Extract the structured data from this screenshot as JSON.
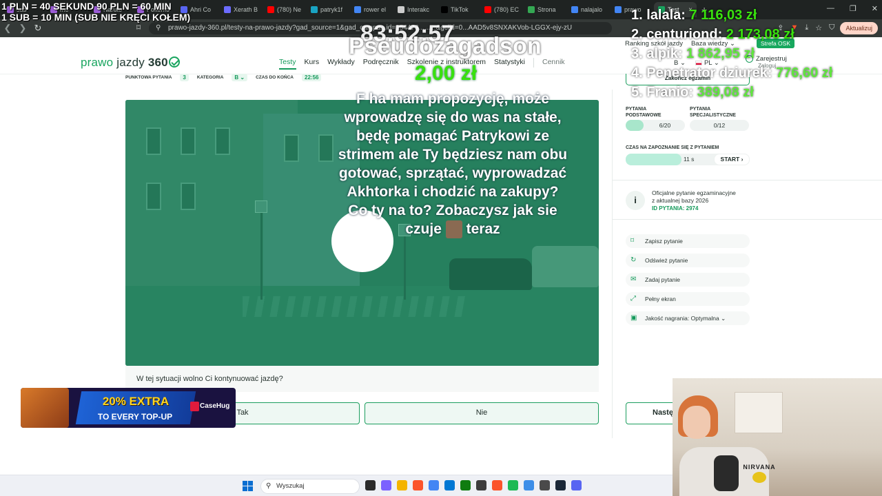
{
  "browser": {
    "tabs": [
      {
        "label": "sub",
        "color": "#9b5cd6"
      },
      {
        "label": "mo",
        "color": "#9b5cd6"
      },
      {
        "label": "Naruto",
        "color": "#9b5cd6"
      },
      {
        "label": "Pokémo",
        "color": "#9b5cd6"
      },
      {
        "label": "Ahri Co",
        "color": "#5865f2"
      },
      {
        "label": "Xerath B",
        "color": "#6c6cff"
      },
      {
        "label": "(780) Ne",
        "color": "#ff0000"
      },
      {
        "label": "patryk1f",
        "color": "#19a3c2"
      },
      {
        "label": "rower el",
        "color": "#4285f4"
      },
      {
        "label": "Interakc",
        "color": "#cccccc"
      },
      {
        "label": "TikTok",
        "color": "#000000"
      },
      {
        "label": "(780) EC",
        "color": "#ff0000"
      },
      {
        "label": "Strona",
        "color": "#34a853"
      },
      {
        "label": "nalajalo",
        "color": "#4285f4"
      },
      {
        "label": "prawo",
        "color": "#4285f4"
      },
      {
        "label": "Test",
        "color": "#19a55f"
      }
    ],
    "tab_close_glyph": "×",
    "new_tab_glyph": "+",
    "window_controls": [
      "—",
      "❐",
      "✕"
    ],
    "nav_glyphs": [
      "❮",
      "❯",
      "↻"
    ],
    "url": "prawo-jazdy-360.pl/testy-na-prawo-jazdy?gad_source=1&gad_campa...id=154473.........&gclid=0...AAD5v8SNXAKVob-LGGX-ejy-zU",
    "update_label": "Aktualizuj",
    "extension_icons": [
      "share-icon",
      "brave-shield-icon",
      "download-icon",
      "star-icon",
      "shield-icon",
      "profile-icon"
    ]
  },
  "site": {
    "logo": {
      "part1": "prawo",
      "part2": "jazdy",
      "part3": "360"
    },
    "nav": [
      {
        "label": "Testy",
        "active": true
      },
      {
        "label": "Kurs",
        "active": false
      },
      {
        "label": "Wykłady",
        "active": false
      },
      {
        "label": "Podręcznik",
        "active": false
      },
      {
        "label": "Szkolenie z instruktorem",
        "active": false
      },
      {
        "label": "Statystyki",
        "active": false
      }
    ],
    "nav_extra": "Cennik",
    "top_links": [
      "Ranking szkół jazdy",
      "Baza wiedzy ⌄"
    ],
    "strefa": "Strefa OSK",
    "category_select": "B ⌄",
    "language": "PL ⌄",
    "register": "Zarejestruj",
    "login": "Zaloguj"
  },
  "question_header": {
    "points_label": "PUNKTOWA PYTANIA",
    "points_value": "3",
    "category_label": "KATEGORIA",
    "category_value": "B ⌄",
    "time_label": "CZAS DO KOŃCA",
    "time_value": "22:56",
    "finish_label": "Zakończ egzamin"
  },
  "question": {
    "text": "W tej sytuacji wolno Ci kontynuować jazdę?",
    "answers": [
      "Tak",
      "Nie"
    ],
    "next_label": "Następne"
  },
  "sidebar": {
    "basic_label_1": "PYTANIA",
    "basic_label_2": "PODSTAWOWE",
    "basic_value": "6/20",
    "basic_progress": 0.3,
    "special_label_1": "PYTANIA",
    "special_label_2": "SPECJALISTYCZNE",
    "special_value": "0/12",
    "timer_label": "CZAS NA ZAPOZNANIE SIĘ Z PYTANIEM",
    "timer_value": "11 s",
    "timer_progress": 0.45,
    "start_label": "START ›",
    "info_line1": "Oficjalne pytanie egzaminacyjne",
    "info_line2": "z aktualnej bazy 2026",
    "info_id": "ID PYTANIA: 2974",
    "actions": [
      {
        "label": "Zapisz pytanie",
        "icon": "bookmark-icon",
        "glyph": "⌑"
      },
      {
        "label": "Odśwież pytanie",
        "icon": "refresh-icon",
        "glyph": "↻"
      },
      {
        "label": "Zadaj pytanie",
        "icon": "chat-icon",
        "glyph": "✉"
      },
      {
        "label": "Pełny ekran",
        "icon": "fullscreen-icon",
        "glyph": "⤢"
      },
      {
        "label": "Jakość nagrania: Optymalna ⌄",
        "icon": "quality-icon",
        "glyph": "▣"
      }
    ]
  },
  "taskbar": {
    "search_placeholder": "Wyszukaj",
    "pinned": [
      {
        "icon": "task-view-icon",
        "color": "#2b2b2b"
      },
      {
        "icon": "copilot-icon",
        "color": "#7b61ff"
      },
      {
        "icon": "file-explorer-icon",
        "color": "#f4b400"
      },
      {
        "icon": "brave-icon",
        "color": "#fb542b"
      },
      {
        "icon": "chrome-icon",
        "color": "#4285f4"
      },
      {
        "icon": "store-icon",
        "color": "#0078d4"
      },
      {
        "icon": "xbox-icon",
        "color": "#107c10"
      },
      {
        "icon": "obs-icon",
        "color": "#3c3c3c"
      },
      {
        "icon": "brave-beta-icon",
        "color": "#fb542b"
      },
      {
        "icon": "spotify-icon",
        "color": "#1db954"
      },
      {
        "icon": "notepad-icon",
        "color": "#3d8ee8"
      },
      {
        "icon": "calculator-icon",
        "color": "#4a4a4a"
      },
      {
        "icon": "steam-icon",
        "color": "#1b2838"
      },
      {
        "icon": "discord-icon",
        "color": "#5865f2"
      }
    ]
  },
  "overlay": {
    "rates_line1": "1 PLN =  40 SEKUND 90 PLN = 60 MIN",
    "rates_line2": "1 SUB = 10 MIN (SUB NIE KRĘCI KOŁEM)",
    "countdown": "83:52:57",
    "donor": "Pseudozagadson",
    "donation_amount": "2,00 zł",
    "message_parts": [
      "F ha mam propozycję, może wprowadzę się do was na stałe, będę pomagać Patrykowi ze strimem ale Ty będziesz nam obu gotować, sprzątać, wyprowadzać Akhtorka i chodzić na zakupy? Co ty na to? Zobaczysz jak sie czuje",
      "teraz"
    ],
    "ranking": [
      {
        "name": "1. lalala: ",
        "amount": "7 116,03 zł"
      },
      {
        "name": "2. centuriond: ",
        "amount": "2 173,08 zł"
      },
      {
        "name": "3. alpik: ",
        "amount": "1 862,95 zł"
      },
      {
        "name": "4. Penetrator dziurek: ",
        "amount": "776,60 zł"
      },
      {
        "name": "5. Franio: ",
        "amount": "389,08 zł"
      }
    ],
    "promo_line1": "20% EXTRA",
    "promo_line2": "TO EVERY TOP-UP",
    "promo_brand": "CaseHug",
    "shirt_print": "NIRVANA"
  }
}
